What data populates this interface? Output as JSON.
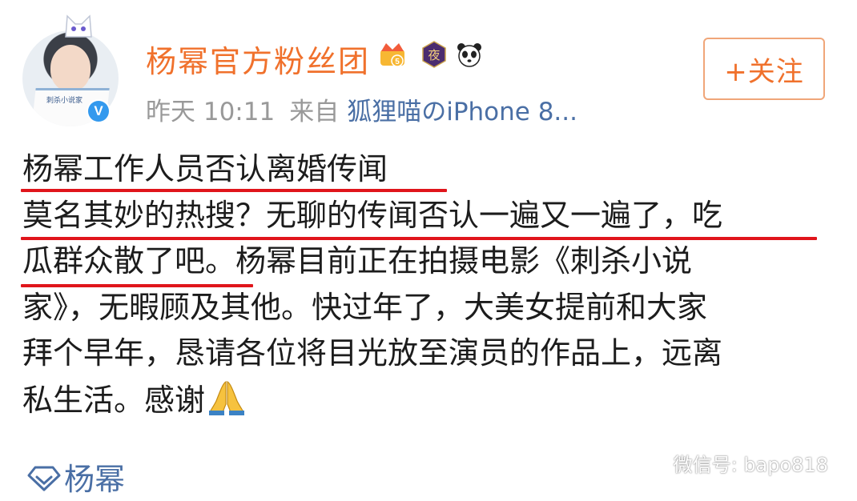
{
  "header": {
    "username": "杨幂官方粉丝团",
    "time": "昨天 10:11",
    "from_label": "来自",
    "source": "狐狸喵のiPhone 8...",
    "follow_label": "+关注",
    "badges": [
      "crown-vip-icon",
      "night-badge-icon",
      "panda-badge-icon"
    ],
    "avatar_book_text": "刺杀小说家",
    "verified_mark": "V"
  },
  "post": {
    "lines": [
      "杨幂工作人员否认离婚传闻",
      "莫名其妙的热搜？无聊的传闻否认一遍又一遍了，吃",
      "瓜群众散了吧。杨幂目前正在拍摄电影《刺杀小说",
      "家》，无暇顾及其他。快过年了，大美女提前和大家",
      "拜个早年，恳请各位将目光放至演员的作品上，远离",
      "私生活。感谢"
    ],
    "emoji": "pray-hands-icon"
  },
  "topic": {
    "label": "杨幂"
  },
  "watermark": {
    "text": "微信号: bapo818"
  },
  "colors": {
    "username": "#f0712c",
    "link": "#4a6fa5",
    "meta": "#999999",
    "underline": "#e0151b",
    "follow_border": "#f0a679",
    "verified": "#3399ee"
  }
}
